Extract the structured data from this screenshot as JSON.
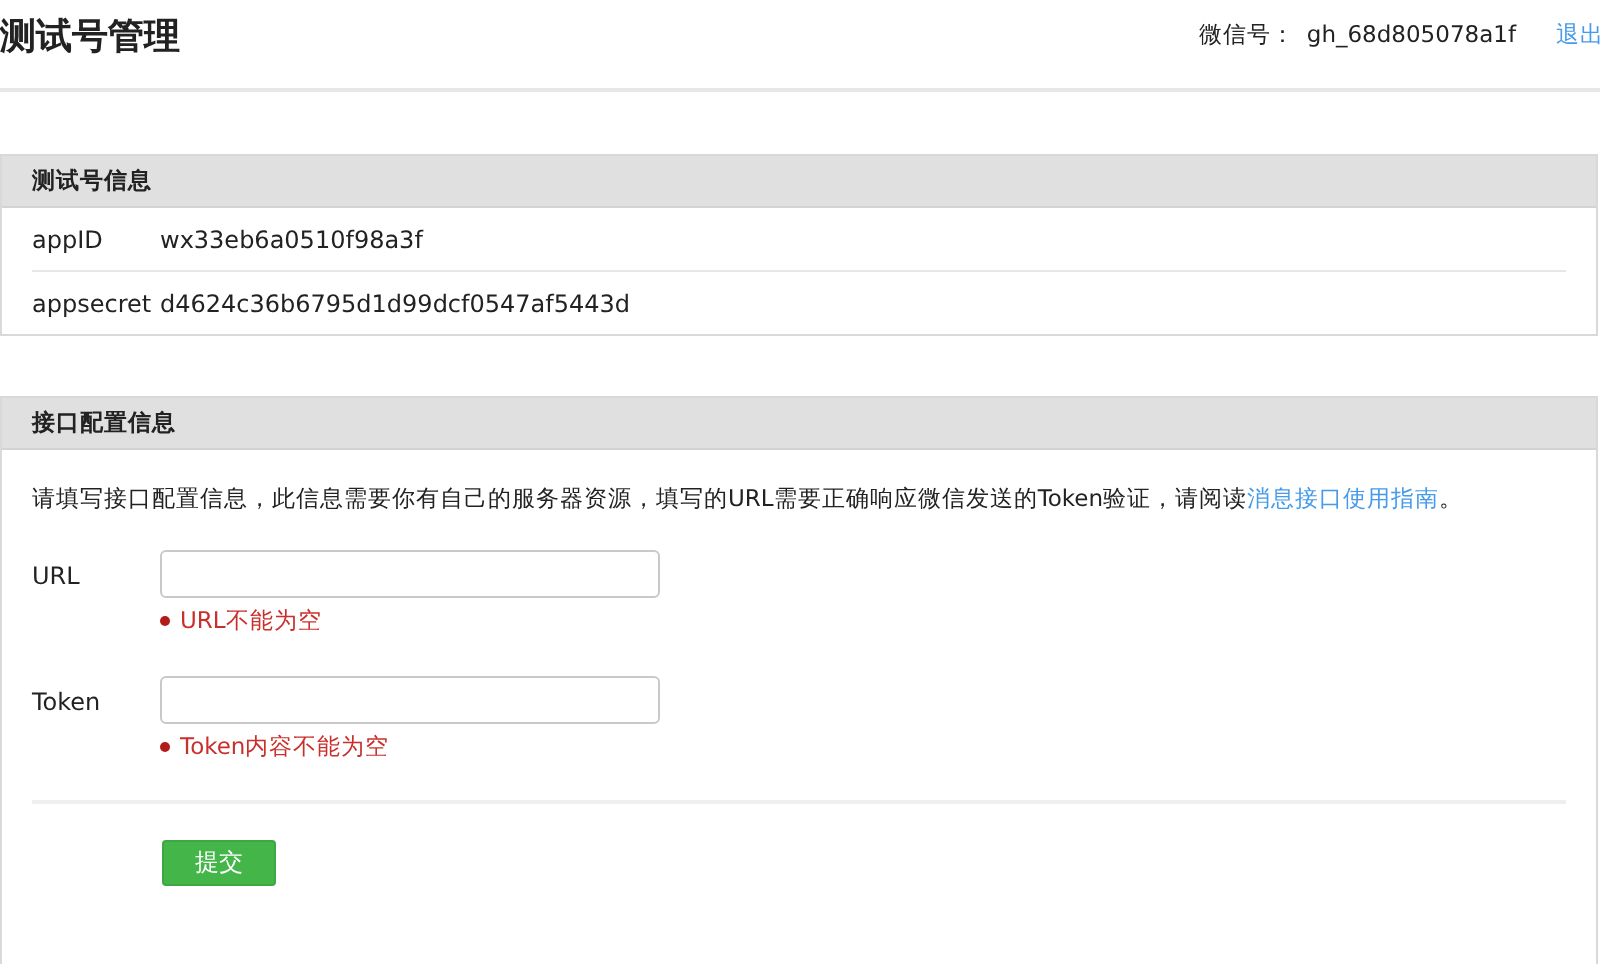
{
  "header": {
    "title": "测试号管理",
    "account_label": "微信号：",
    "account_id": "gh_68d805078a1f",
    "logout": "退出"
  },
  "test_account": {
    "title": "测试号信息",
    "rows": [
      {
        "label": "appID",
        "value": "wx33eb6a0510f98a3f"
      },
      {
        "label": "appsecret",
        "value": "d4624c36b6795d1d99dcf0547af5443d"
      }
    ]
  },
  "interface_config": {
    "title": "接口配置信息",
    "description": "请填写接口配置信息，此信息需要你有自己的服务器资源，填写的URL需要正确响应微信发送的Token验证，请阅读",
    "link": "消息接口使用指南",
    "description_end": "。",
    "fields": [
      {
        "label": "URL",
        "error": "URL不能为空"
      },
      {
        "label": "Token",
        "error": "Token内容不能为空"
      }
    ],
    "submit": "提交"
  }
}
